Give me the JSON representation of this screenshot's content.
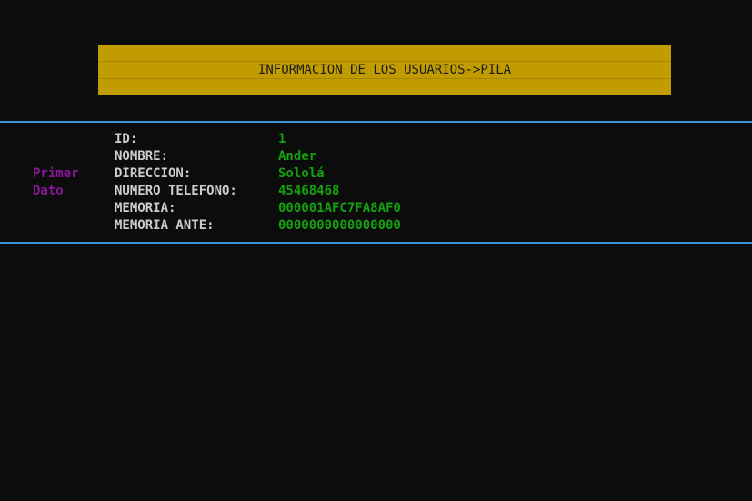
{
  "banner": {
    "title": "INFORMACION DE LOS USUARIOS->PILA",
    "background_color": "#c19c00"
  },
  "record": {
    "label_line1": "Primer",
    "label_line2": "Dato",
    "fields": [
      {
        "label": "ID:",
        "value": "1"
      },
      {
        "label": "NOMBRE:",
        "value": "Ander"
      },
      {
        "label": "DIRECCION:",
        "value": "Sololá"
      },
      {
        "label": "NUMERO TELEFONO:",
        "value": "45468468"
      },
      {
        "label": "MEMORIA:",
        "value": "000001AFC7FA8AF0"
      },
      {
        "label": "MEMORIA ANTE:",
        "value": "0000000000000000"
      }
    ]
  },
  "colors": {
    "background": "#0c0c0c",
    "separator": "#3a96dd",
    "record_label": "#881798",
    "field_label": "#cccccc",
    "field_value": "#13a10e"
  }
}
